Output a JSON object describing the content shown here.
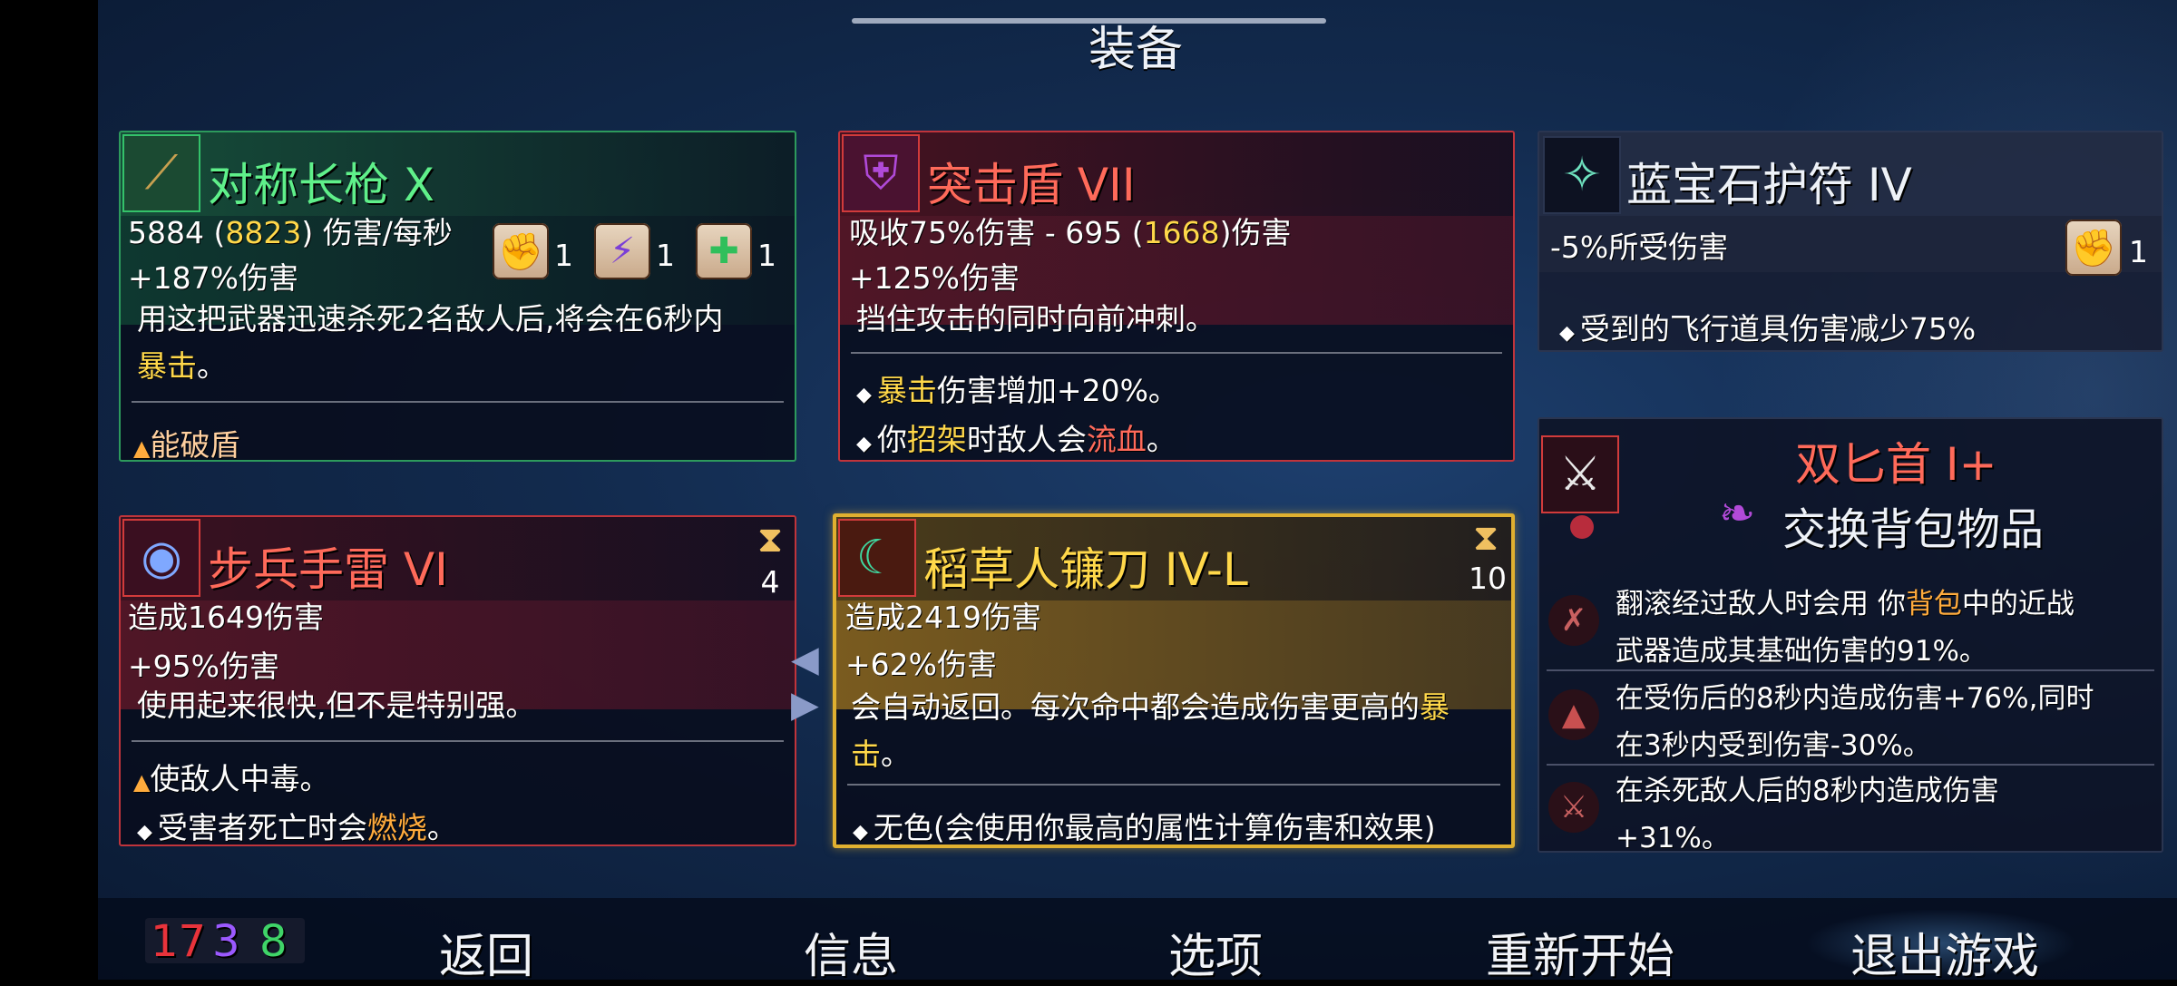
{
  "header": {
    "title": "装备"
  },
  "cards": {
    "spear": {
      "title": "对称长枪 X",
      "stat1": "5884 (",
      "stat1_hi": "8823",
      "stat1_tail": ") 伤害/每秒",
      "stat2": "+187%伤害",
      "desc1": "用这把武器迅速杀死2名敌人后,将会在6秒内",
      "desc2_hi": "暴击",
      "desc2_tail": "。",
      "effect1": "能破盾",
      "scroll_counts": [
        "1",
        "1",
        "1"
      ]
    },
    "shield": {
      "title": "突击盾 VII",
      "stat1": "吸收75%伤害 - 695 (",
      "stat1_hi": "1668",
      "stat1_tail": ")伤害",
      "stat2": "+125%伤害",
      "desc1": "挡住攻击的同时向前冲刺。",
      "effect1_hi": "暴击",
      "effect1_tail": "伤害增加+20%。",
      "effect2_head": "你",
      "effect2_mid": "招架",
      "effect2_mid2": "时敌人会",
      "effect2_hi": "流血",
      "effect2_tail": "。"
    },
    "amulet": {
      "title": "蓝宝石护符 IV",
      "stat1": "-5%所受伤害",
      "scroll_count": "1",
      "effect1": "受到的飞行道具伤害减少75%"
    },
    "grenade": {
      "title": "步兵手雷 VI",
      "cooldown": "4",
      "stat1": "造成1649伤害",
      "stat2": "+95%伤害",
      "desc1": "使用起来很快,但不是特别强。",
      "effect1": "使敌人中毒。",
      "effect2_head": "受害者死亡时会",
      "effect2_hi": "燃烧",
      "effect2_tail": "。"
    },
    "scythe": {
      "title": "稻草人镰刀 IV-L",
      "cooldown": "10",
      "stat1": "造成2419伤害",
      "stat2": "+62%伤害",
      "desc1_head": "会自动返回。每次命中都会造成伤害更高的",
      "desc1_hi": "暴",
      "desc2_hi": "击",
      "desc2_tail": "。",
      "effect1": "无色(会使用你最高的属性计算伤害和效果)"
    },
    "daggers": {
      "title": "双匕首 I+",
      "swap": "交换背包物品",
      "line1a": "翻滚经过敌人时会用 你",
      "line1_hi": "背包",
      "line1b": "中的近战",
      "line2": "武器造成其基础伤害的91%。",
      "line3": "在受伤后的8秒内造成伤害+76%,同时",
      "line4": "在3秒内受到伤害-30%。",
      "line5": "在杀死敌人后的8秒内造成伤害",
      "line6": "+31%。"
    }
  },
  "stats": {
    "brutality": "17",
    "tactics": "3",
    "survival": "8",
    "colors": {
      "brutality": "#e8333b",
      "tactics": "#9b59ff",
      "survival": "#3fd468"
    }
  },
  "menu": {
    "back": "返回",
    "info": "信息",
    "options": "选项",
    "restart": "重新开始",
    "quit": "退出游戏"
  },
  "icons": {
    "spear": "spear-icon",
    "shield": "shield-icon",
    "amulet": "amulet-icon",
    "grenade": "grenade-icon",
    "scythe": "scythe-icon",
    "daggers": "daggers-icon",
    "hourglass": "hourglass-icon",
    "scroll": "scroll-icon"
  }
}
